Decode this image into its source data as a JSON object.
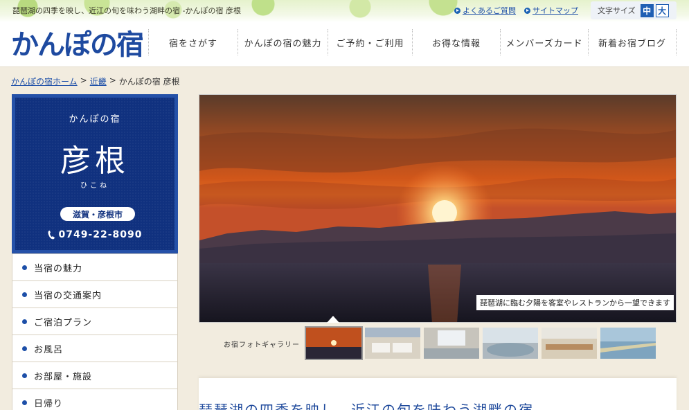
{
  "header": {
    "tagline": "琵琶湖の四季を映し、近江の旬を味わう湖畔の宿 -かんぽの宿 彦根",
    "util_links": [
      "よくあるご質問",
      "サイトマップ"
    ],
    "font_size_label": "文字サイズ",
    "font_size_options": [
      "中",
      "大"
    ],
    "font_size_selected": "中",
    "logo_text": "かんぽの宿",
    "nav": [
      "宿をさがす",
      "かんぽの宿の魅力",
      "ご予約・ご利用",
      "お得な情報",
      "メンバーズカード",
      "新着お宿ブログ"
    ]
  },
  "breadcrumb": {
    "items": [
      "かんぽの宿ホーム",
      "近畿"
    ],
    "separator": ">",
    "current": "かんぽの宿 彦根"
  },
  "hotel_card": {
    "brand": "かんぽの宿",
    "name": "彦根",
    "kana": "ひこね",
    "area": "滋賀・彦根市",
    "tel": "0749-22-8090"
  },
  "side_menu": [
    "当宿の魅力",
    "当宿の交通案内",
    "ご宿泊プラン",
    "お風呂",
    "お部屋・施設",
    "日帰り"
  ],
  "hero": {
    "caption": "琵琶湖に臨む夕陽を客室やレストランから一望できます"
  },
  "gallery": {
    "label": "お宿フォトギャラリー",
    "thumbnails": [
      "sunset-thumb",
      "guest-room-thumb",
      "bath-thumb",
      "open-air-bath-thumb",
      "restaurant-thumb",
      "lake-shore-thumb"
    ],
    "active_index": 0
  },
  "main": {
    "heading": "琵琶湖の四季を映し、近江の旬を味わう湖畔の宿"
  },
  "colors": {
    "brand_blue": "#1e4aa0",
    "card_navy": "#10317f",
    "link_blue": "#1d4fa8",
    "page_beige": "#f2ecdf"
  }
}
